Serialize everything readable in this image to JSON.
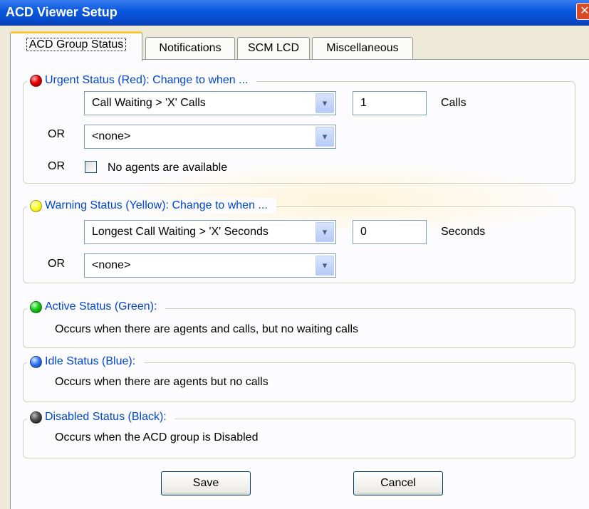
{
  "window": {
    "title": "ACD Viewer Setup",
    "close_glyph": "✕"
  },
  "tabs": [
    {
      "label": "ACD Group Status",
      "active": true
    },
    {
      "label": "Notifications",
      "active": false
    },
    {
      "label": "SCM LCD",
      "active": false
    },
    {
      "label": "Miscellaneous",
      "active": false
    }
  ],
  "urgent": {
    "legend": "Urgent Status (Red): Change to when ...",
    "color": "#e00000",
    "condition1": "Call Waiting > 'X' Calls",
    "value1": "1",
    "unit1": "Calls",
    "or_label": "OR",
    "condition2": "<none>",
    "or_label2": "OR",
    "checkbox_label": "No agents are available",
    "checkbox_checked": false
  },
  "warning": {
    "legend": "Warning Status (Yellow): Change to when ...",
    "color": "#ffff30",
    "condition1": "Longest Call Waiting > 'X' Seconds",
    "value1": "0",
    "unit1": "Seconds",
    "or_label": "OR",
    "condition2": "<none>"
  },
  "active": {
    "legend": "Active Status (Green):",
    "color": "#18c818",
    "description": "Occurs when there are agents and calls, but no waiting calls"
  },
  "idle": {
    "legend": "Idle Status (Blue):",
    "color": "#3a78f0",
    "description": "Occurs when there are agents but no calls"
  },
  "disabled": {
    "legend": "Disabled Status (Black):",
    "color": "#505050",
    "description": "Occurs when the ACD  group is Disabled"
  },
  "buttons": {
    "save": "Save",
    "cancel": "Cancel"
  },
  "icons": {
    "dropdown": "chevron-down-icon",
    "dropdown_glyph": "▾"
  }
}
